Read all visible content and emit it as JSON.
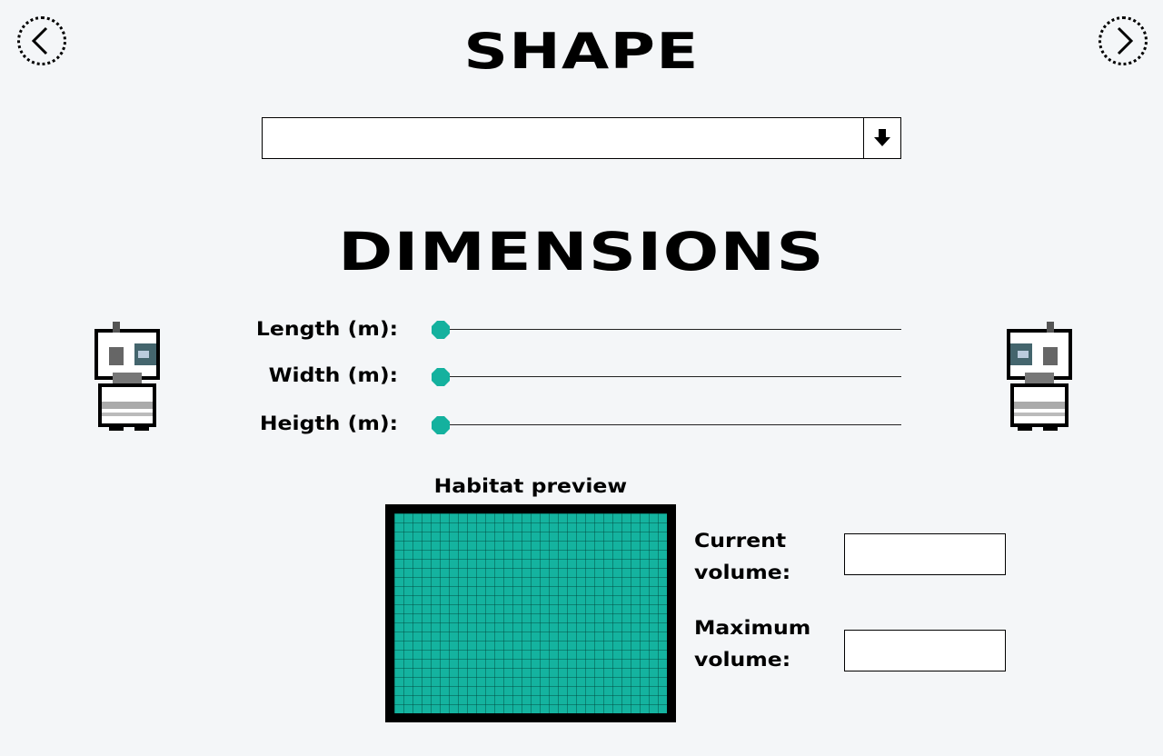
{
  "nav": {
    "prev_icon": "chevron-left-icon",
    "next_icon": "chevron-right-icon"
  },
  "shape": {
    "title": "SHAPE",
    "selected_value": "",
    "dropdown_icon": "arrow-down-icon"
  },
  "dimensions": {
    "title": "DIMENSIONS",
    "sliders": [
      {
        "label": "Length (m):",
        "value_fraction": 0
      },
      {
        "label": "Width (m):",
        "value_fraction": 0
      },
      {
        "label": "Heigth (m):",
        "value_fraction": 0
      }
    ]
  },
  "preview": {
    "title": "Habitat preview",
    "fill_color": "#14b39f"
  },
  "volume": {
    "current_label": "Current volume:",
    "current_value": "",
    "maximum_label": "Maximum volume:",
    "maximum_value": ""
  },
  "colors": {
    "accent": "#14b19e",
    "background": "#f4f6f8"
  },
  "mascots": [
    "robot-mascot-icon",
    "robot-mascot-icon"
  ]
}
